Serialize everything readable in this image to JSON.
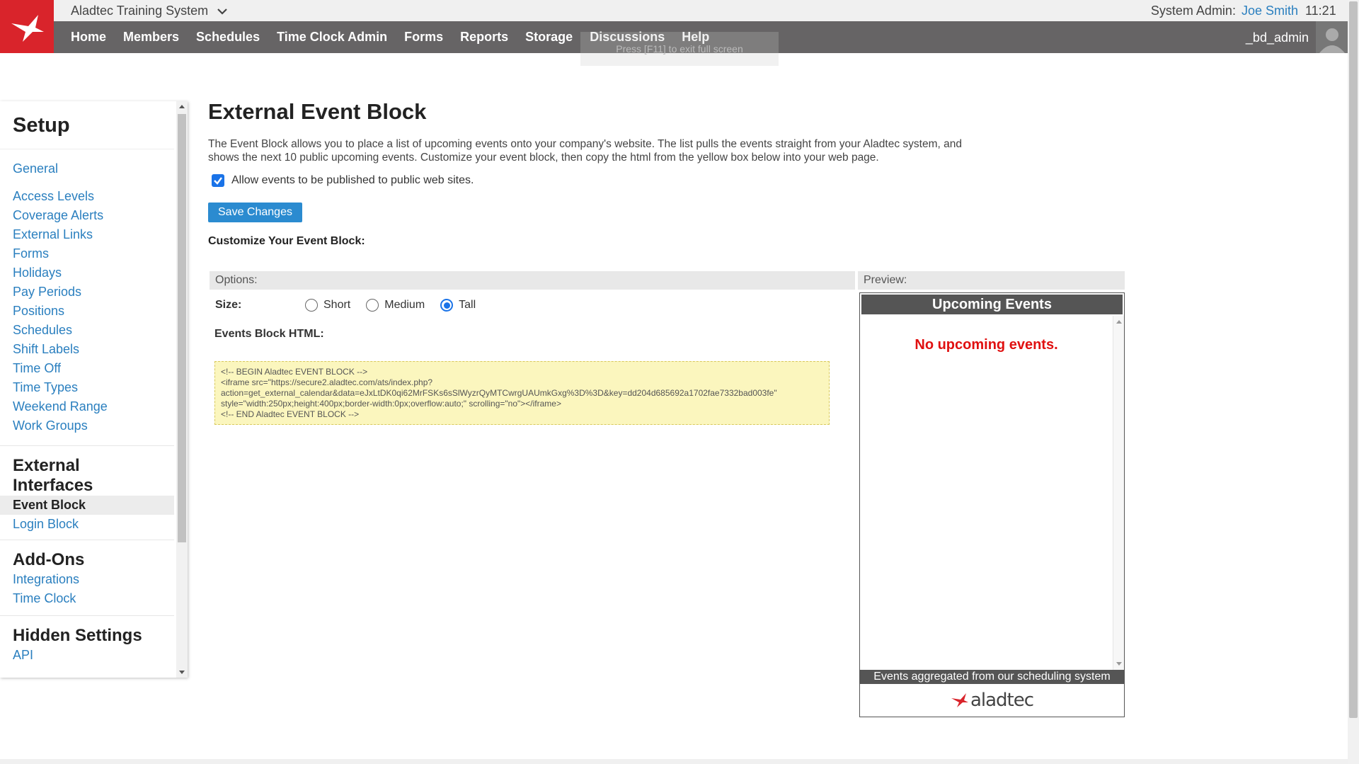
{
  "header": {
    "app_title": "Aladtec Training System",
    "role_label": "System Admin:",
    "user_name": "Joe Smith",
    "time": "11:21",
    "username": "_bd_admin",
    "fullscreen_hint": "Press [F11] to exit full screen",
    "nav": [
      "Home",
      "Members",
      "Schedules",
      "Time Clock Admin",
      "Forms",
      "Reports",
      "Storage",
      "Discussions",
      "Help"
    ],
    "brand_color": "#d9242b",
    "nav_color": "#666465"
  },
  "sidebar": {
    "heading": "Setup",
    "setup_items": [
      "General",
      "Access Levels",
      "Coverage Alerts",
      "External Links",
      "Forms",
      "Holidays",
      "Pay Periods",
      "Positions",
      "Schedules",
      "Shift Labels",
      "Time Off",
      "Time Types",
      "Weekend Range",
      "Work Groups"
    ],
    "external_heading": "External Interfaces",
    "external_items": [
      "Event Block",
      "Login Block"
    ],
    "addons_heading": "Add-Ons",
    "addons_items": [
      "Integrations",
      "Time Clock"
    ],
    "hidden_heading": "Hidden Settings",
    "hidden_items": [
      "API"
    ]
  },
  "main": {
    "title": "External Event Block",
    "description": "The Event Block allows you to place a list of upcoming events onto your company's website. The list pulls the events straight from your Aladtec system, and shows the next 10 public upcoming events. Customize your event block, then copy the html from the yellow box below into your web page.",
    "allow_label": "Allow events to be published to public web sites.",
    "allow_checked": true,
    "save_label": "Save Changes",
    "customize_label": "Customize Your Event Block:",
    "options_label": "Options:",
    "preview_label": "Preview:",
    "size_label": "Size:",
    "size_options": [
      "Short",
      "Medium",
      "Tall"
    ],
    "size_selected": "Tall",
    "html_label": "Events Block HTML:",
    "html_code": "<!-- BEGIN Aladtec EVENT BLOCK -->\n<iframe src=\"https://secure2.aladtec.com/ats/index.php?\naction=get_external_calendar&data=eJxLtDK0qi62MrFSKs6sSlWyzrQyMTCwrgUAUmkGxg%3D%3D&key=dd204d685692a1702fae7332bad003fe\"\nstyle=\"width:250px;height:400px;border-width:0px;overflow:auto;\" scrolling=\"no\"></iframe>\n<!-- END Aladtec EVENT BLOCK -->"
  },
  "preview": {
    "header": "Upcoming Events",
    "empty_message": "No upcoming events.",
    "footer": "Events aggregated from our scheduling system",
    "logo_word": "aladtec"
  }
}
